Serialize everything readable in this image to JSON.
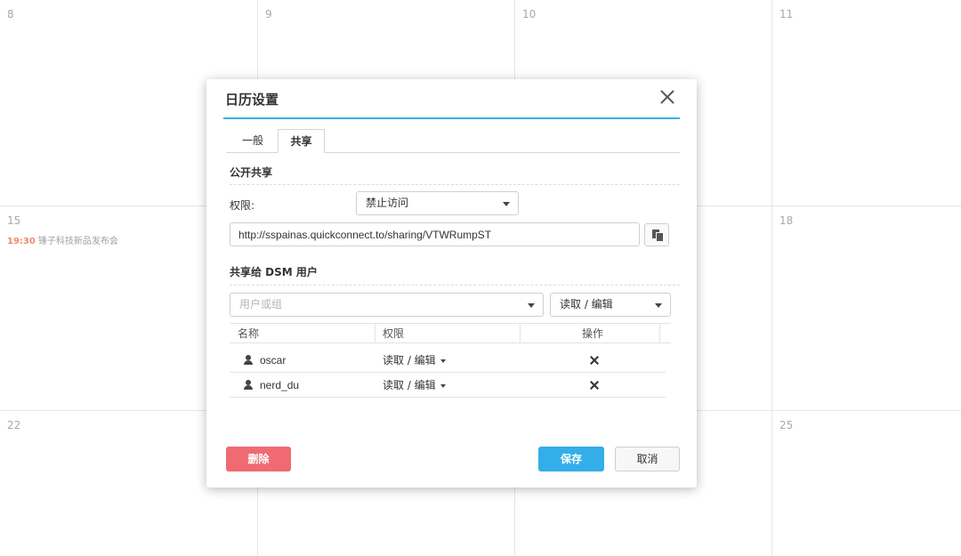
{
  "calendar": {
    "days": [
      "8",
      "9",
      "10",
      "11",
      "15",
      "18",
      "22",
      "25"
    ],
    "event": {
      "time": "19:30",
      "title": "锤子科技新品发布会"
    }
  },
  "dialog": {
    "title": "日历设置",
    "tabs": [
      "一般",
      "共享"
    ],
    "active_tab": "共享",
    "public_share": {
      "section_title": "公开共享",
      "permission_label": "权限:",
      "permission_value": "禁止访问",
      "url": "http://sspainas.quickconnect.to/sharing/VTWRumpST"
    },
    "dsm_share": {
      "section_title": "共享给 DSM 用户",
      "user_placeholder": "用户或组",
      "permission_value": "读取 / 编辑",
      "columns": [
        "名称",
        "权限",
        "操作"
      ],
      "rows": [
        {
          "name": "oscar",
          "permission": "读取 / 编辑"
        },
        {
          "name": "nerd_du",
          "permission": "读取 / 编辑"
        }
      ]
    },
    "buttons": {
      "delete": "删除",
      "save": "保存",
      "cancel": "取消"
    }
  },
  "colors": {
    "accent": "#33aee8",
    "danger": "#ef6a72",
    "event_time": "#f08a6c"
  },
  "icons": [
    "close-icon",
    "copy-icon",
    "user-icon",
    "remove-icon",
    "chevron-down-icon"
  ]
}
